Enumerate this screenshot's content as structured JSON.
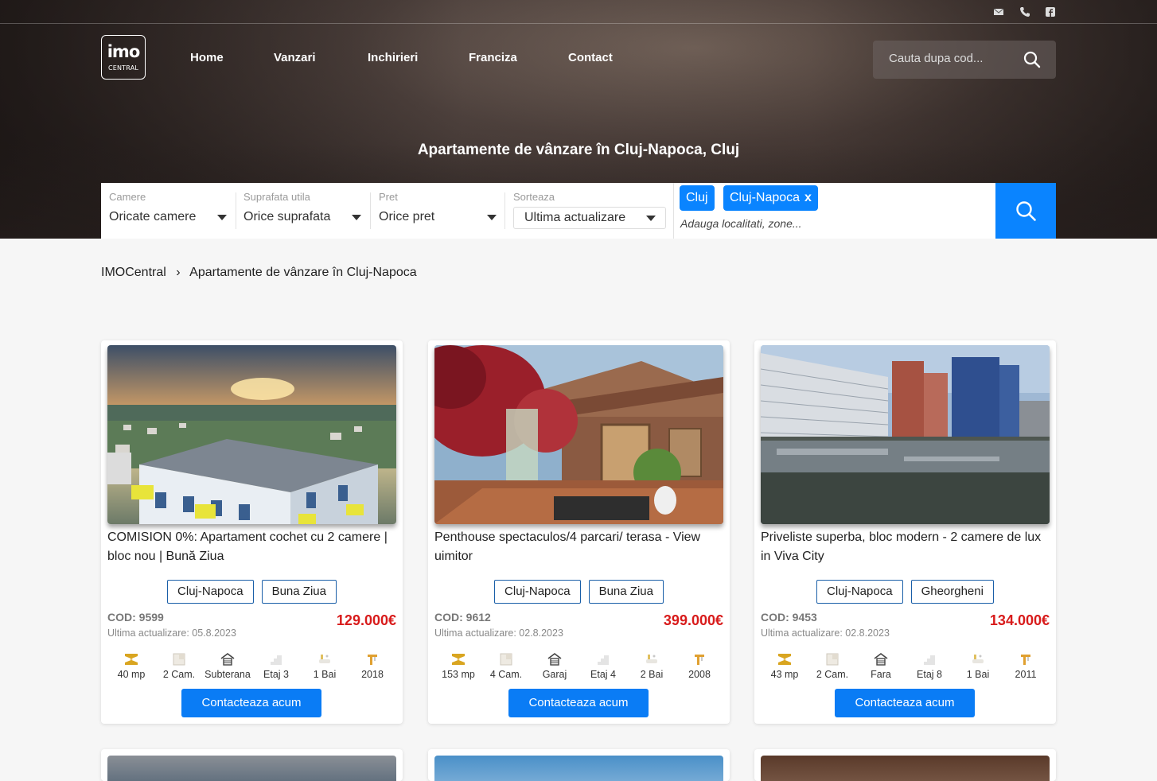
{
  "topbar": {
    "icons": [
      "mail-icon",
      "phone-icon",
      "facebook-icon"
    ]
  },
  "logo": {
    "big": "imo",
    "small": "CENTRAL"
  },
  "nav": {
    "items": [
      "Home",
      "Vanzari",
      "Inchirieri",
      "Franciza",
      "Contact"
    ]
  },
  "header_search": {
    "placeholder": "Cauta dupa cod..."
  },
  "hero": {
    "title": "Apartamente de vânzare în Cluj-Napoca, Cluj"
  },
  "filters": {
    "rooms": {
      "label": "Camere",
      "value": "Oricate camere"
    },
    "area": {
      "label": "Suprafata utila",
      "value": "Orice suprafata"
    },
    "price": {
      "label": "Pret",
      "value": "Orice pret"
    },
    "sort": {
      "label": "Sorteaza",
      "value": "Ultima actualizare"
    },
    "locations": {
      "tags": [
        "Cluj",
        "Cluj-Napoca"
      ],
      "remove": "x",
      "placeholder": "Adauga localitati, zone..."
    }
  },
  "breadcrumb": {
    "home": "IMOCentral",
    "sep": "›",
    "current": "Apartamente de vânzare în Cluj-Napoca"
  },
  "listings": [
    {
      "title": "COMISION 0%: Apartament cochet cu 2 camere | bloc nou | Bună Ziua",
      "chips": [
        "Cluj-Napoca",
        "Buna Ziua"
      ],
      "cod": "COD: 9599",
      "updated": "Ultima actualizare: 05.8.2023",
      "price": "129.000€",
      "features": [
        "40 mp",
        "2 Cam.",
        "Subterana",
        "Etaj 3",
        "1 Bai",
        "2018"
      ],
      "cta": "Contacteaza acum"
    },
    {
      "title": "Penthouse spectaculos/4 parcari/ terasa - View uimitor",
      "chips": [
        "Cluj-Napoca",
        "Buna Ziua"
      ],
      "cod": "COD: 9612",
      "updated": "Ultima actualizare: 02.8.2023",
      "price": "399.000€",
      "features": [
        "153 mp",
        "4 Cam.",
        "Garaj",
        "Etaj 4",
        "2 Bai",
        "2008"
      ],
      "cta": "Contacteaza acum"
    },
    {
      "title": "Priveliste superba, bloc modern - 2 camere de lux in Viva City",
      "chips": [
        "Cluj-Napoca",
        "Gheorgheni"
      ],
      "cod": "COD: 9453",
      "updated": "Ultima actualizare: 02.8.2023",
      "price": "134.000€",
      "features": [
        "43 mp",
        "2 Cam.",
        "Fara",
        "Etaj 8",
        "1 Bai",
        "2011"
      ],
      "cta": "Contacteaza acum"
    }
  ],
  "feature_icons": [
    "area-icon",
    "rooms-icon",
    "parking-icon",
    "floor-icon",
    "bath-icon",
    "year-icon"
  ],
  "colors": {
    "accent": "#0a84ff",
    "price": "#d81b1b",
    "chip_border": "#1a5fa8"
  }
}
